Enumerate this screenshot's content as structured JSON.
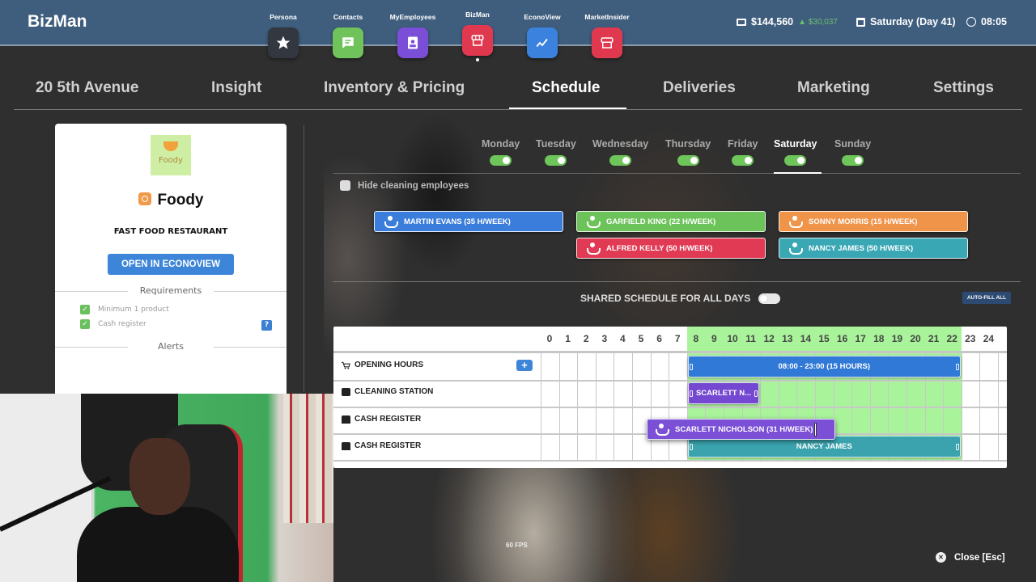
{
  "app": {
    "brand": "BizMan"
  },
  "launcher": [
    {
      "label": "Persona",
      "icon": "star-icon",
      "color": "#33373f"
    },
    {
      "label": "Contacts",
      "icon": "chat-icon",
      "color": "#6fc35a"
    },
    {
      "label": "MyEmployees",
      "icon": "id-badge-icon",
      "color": "#7a4ed6"
    },
    {
      "label": "BizMan",
      "icon": "store-icon",
      "color": "#e0394f",
      "active": true
    },
    {
      "label": "EconoView",
      "icon": "trend-chart-icon",
      "color": "#3b82de"
    },
    {
      "label": "MarketInsider",
      "icon": "store-icon",
      "color": "#e0394f"
    }
  ],
  "status": {
    "money": "$144,560",
    "money_delta": "▲ $30,037",
    "date": "Saturday (Day 41)",
    "time": "08:05"
  },
  "tabs": [
    {
      "label": "20 5th Avenue"
    },
    {
      "label": "Insight"
    },
    {
      "label": "Inventory & Pricing"
    },
    {
      "label": "Schedule",
      "active": true
    },
    {
      "label": "Deliveries"
    },
    {
      "label": "Marketing"
    },
    {
      "label": "Settings"
    }
  ],
  "business": {
    "logo_text": "Foody",
    "name": "Foody",
    "type": "FAST FOOD RESTAURANT",
    "open_button": "OPEN IN ECONOVIEW",
    "requirements_title": "Requirements",
    "requirements": [
      {
        "label": "Minimum 1 product",
        "met": true
      },
      {
        "label": "Cash register",
        "met": true
      }
    ],
    "help": "?",
    "alerts_title": "Alerts"
  },
  "days": [
    {
      "label": "Monday",
      "enabled": true
    },
    {
      "label": "Tuesday",
      "enabled": true
    },
    {
      "label": "Wednesday",
      "enabled": true
    },
    {
      "label": "Thursday",
      "enabled": true
    },
    {
      "label": "Friday",
      "enabled": true
    },
    {
      "label": "Saturday",
      "enabled": true,
      "active": true
    },
    {
      "label": "Sunday",
      "enabled": true
    }
  ],
  "hide_cleaning": {
    "label": "Hide cleaning employees",
    "checked": false
  },
  "employees": [
    {
      "label": "MARTIN EVANS (35 H/WEEK)",
      "color": "#3b7ddb"
    },
    {
      "label": "GARFIELD KING (22 H/WEEK)",
      "color": "#6cc35a"
    },
    {
      "label": "SONNY MORRIS (15 H/WEEK)",
      "color": "#f0944a"
    },
    {
      "label": "ALFRED KELLY (50 H/WEEK)",
      "color": "#e03a55"
    },
    {
      "label": "NANCY JAMES (50 H/WEEK)",
      "color": "#3aa7b5"
    }
  ],
  "shared_schedule": {
    "label": "SHARED SCHEDULE FOR ALL DAYS",
    "enabled": false
  },
  "autofill_button": "AUTO-FILL ALL",
  "schedule": {
    "hours": [
      "0",
      "1",
      "2",
      "3",
      "4",
      "5",
      "6",
      "7",
      "8",
      "9",
      "10",
      "11",
      "12",
      "13",
      "14",
      "15",
      "16",
      "17",
      "18",
      "19",
      "20",
      "21",
      "22",
      "23",
      "24"
    ],
    "open_from": 8,
    "open_to": 23,
    "rows": [
      {
        "label": "OPENING HOURS",
        "icon": "cart-icon"
      },
      {
        "label": "CLEANING STATION",
        "icon": "cleaning-icon"
      },
      {
        "label": "CASH REGISTER",
        "icon": "cash-register-icon"
      },
      {
        "label": "CASH REGISTER",
        "icon": "cash-register-icon"
      }
    ],
    "blocks": [
      {
        "row": 0,
        "start": 8,
        "end": 23,
        "label": "08:00 - 23:00 (15 HOURS)",
        "color": "#3079d6"
      },
      {
        "row": 1,
        "start": 8,
        "end": 12,
        "label": "SCARLETT N...",
        "color": "#7448d0"
      },
      {
        "row": 3,
        "start": 8,
        "end": 23,
        "label": "NANCY JAMES",
        "color": "#3aa3ae"
      }
    ],
    "dragging": {
      "label": "SCARLETT NICHOLSON (31 H/WEEK)",
      "color": "#7b4fd6"
    }
  },
  "footer": {
    "fps": "60 FPS",
    "close": "Close [Esc]"
  }
}
